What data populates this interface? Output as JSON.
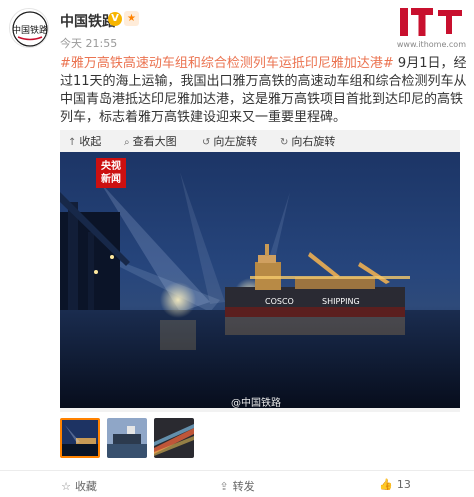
{
  "account": {
    "name": "中国铁路",
    "timestamp": "今天 21:55"
  },
  "post": {
    "topic": "#雅万高铁高速动车组和综合检测列车运抵印尼雅加达港#",
    "body": " 9月1日，经过11天的海上运输，我国出口雅万高铁的高速动车组和综合检测列车从中国青岛港抵达印尼雅加达港，这是雅万高铁项目首批到达印尼的高铁列车，标志着雅万高铁建设迎来又一重要里程碑。"
  },
  "viewer_toolbar": [
    {
      "label": "收起",
      "icon": "collapse-icon"
    },
    {
      "label": "查看大图",
      "icon": "zoom-icon"
    },
    {
      "label": "向左旋转",
      "icon": "rotate-left-icon"
    },
    {
      "label": "向右旋转",
      "icon": "rotate-right-icon"
    }
  ],
  "photo": {
    "cctv_line1": "央视",
    "cctv_line2": "新闻",
    "ship_text_left": "COSCO",
    "ship_text_right": "SHIPPING",
    "watermark": "@中国铁路"
  },
  "thumbnails": [
    {
      "icon": "thumbnail-night-port",
      "selected": true
    },
    {
      "icon": "thumbnail-ship",
      "selected": false
    },
    {
      "icon": "thumbnail-train-light",
      "selected": false
    }
  ],
  "actions": [
    {
      "label": "收藏",
      "icon": "star-icon"
    },
    {
      "label": "转发",
      "icon": "share-icon",
      "count": ""
    },
    {
      "label": "13",
      "icon": "like-icon"
    }
  ],
  "brand": {
    "it_logo_text": "IT之家",
    "it_url": "www.ithome.com"
  },
  "colors": {
    "topic": "#eb7350",
    "accent": "#ff8200",
    "badge": "#f7b500"
  }
}
